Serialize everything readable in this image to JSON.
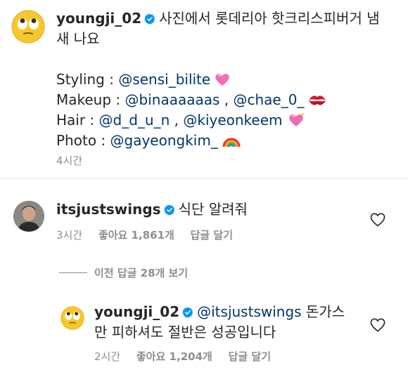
{
  "post": {
    "username": "youngji_02",
    "caption_1": "사진에서 롯데리아 핫크리스피버거 냄",
    "caption_2": "새 나요",
    "credits": [
      {
        "label": "Styling : ",
        "mention1": "@sensi_bilite",
        "sep": "",
        "mention2": "",
        "emoji": "heart"
      },
      {
        "label": "Makeup : ",
        "mention1": "@binaaaaaas",
        "sep": " , ",
        "mention2": "@chae_0_",
        "emoji": "lips"
      },
      {
        "label": "Hair : ",
        "mention1": "@d_d_u_n",
        "sep": " , ",
        "mention2": "@kiyeonkeem",
        "emoji": "sparkle-heart"
      },
      {
        "label": "Photo : ",
        "mention1": "@gayeongkim_",
        "sep": "",
        "mention2": "",
        "emoji": "rainbow"
      }
    ],
    "time": "4시간"
  },
  "comment1": {
    "username": "itsjustswings",
    "text": "식단 알려줘",
    "time": "3시간",
    "likes": "좋아요 1,861개",
    "reply": "답글 달기"
  },
  "view_replies": "이전 답글 28개 보기",
  "reply1": {
    "username": "youngji_02",
    "mention": "@itsjustswings",
    "text_1": " 돈가스",
    "text_2": "만 피하셔도 절반은 성공입니다",
    "time": "2시간",
    "likes": "좋아요 1,204개",
    "reply": "답글 달기"
  },
  "colors": {
    "text": "#262626",
    "link": "#00376b",
    "meta": "#8e8e8e",
    "verified": "#0095f6"
  }
}
